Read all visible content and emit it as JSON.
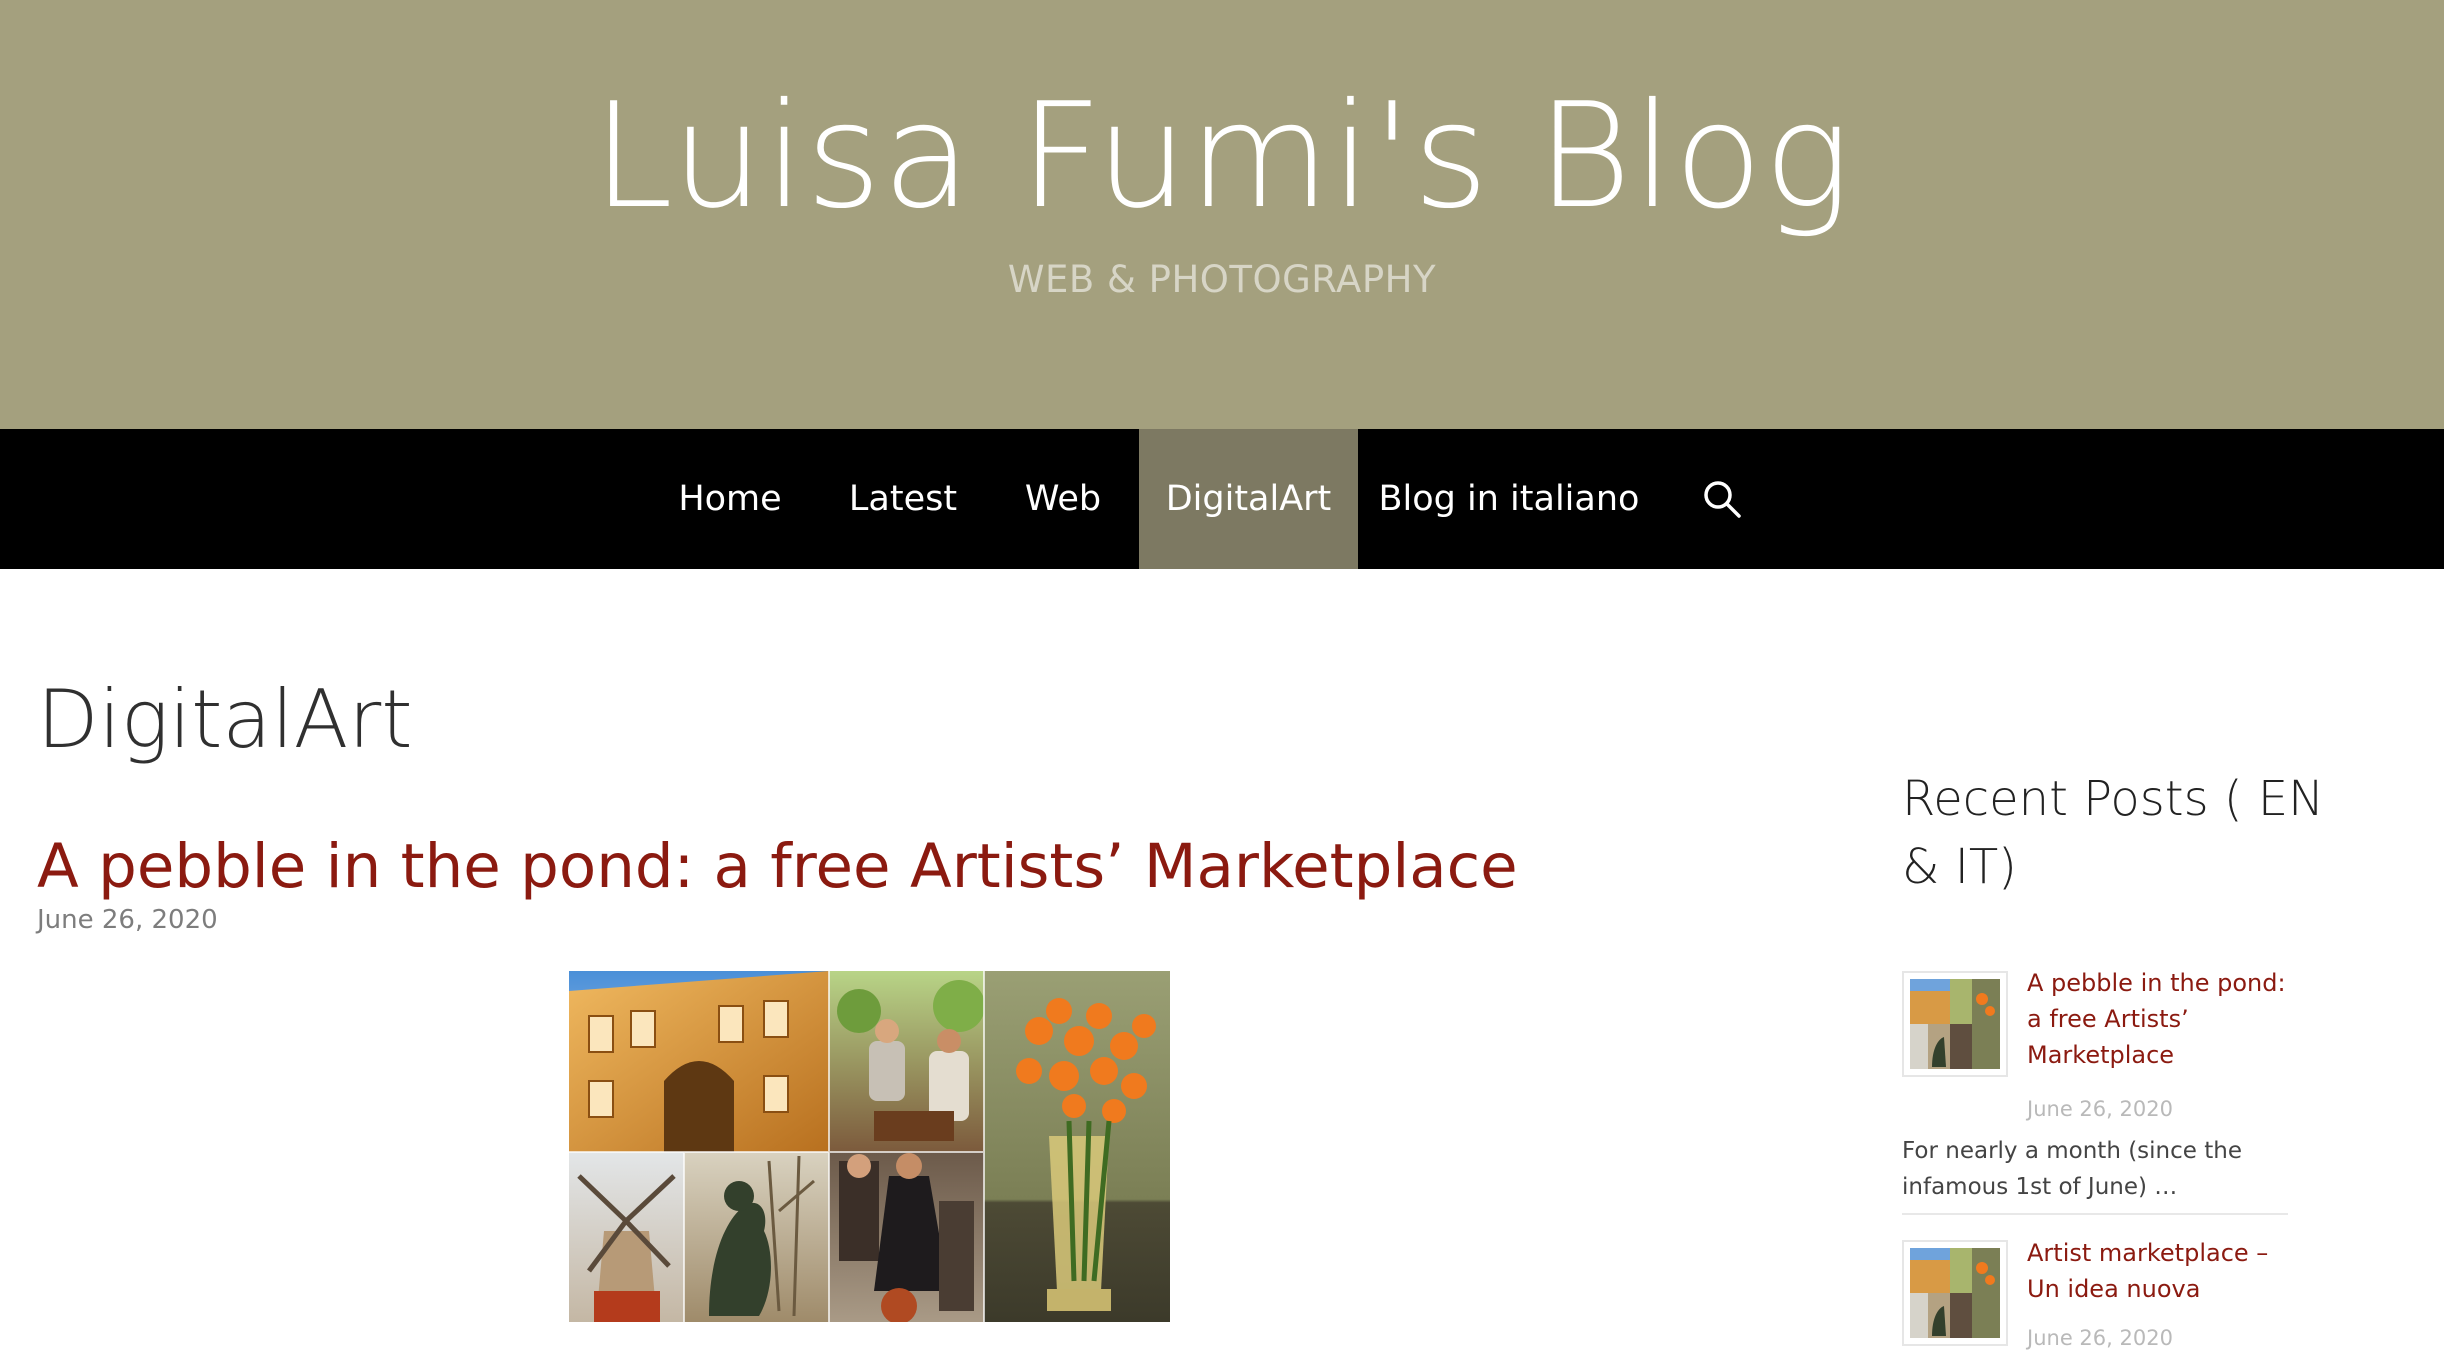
{
  "header": {
    "title": "Luisa Fumi's Blog",
    "tagline": "WEB & PHOTOGRAPHY",
    "background_color": "#a4a07e"
  },
  "nav": {
    "items": [
      {
        "label": "Home"
      },
      {
        "label": "Latest"
      },
      {
        "label": "Web"
      },
      {
        "label": "DigitalArt",
        "active": true
      },
      {
        "label": "Blog in italiano"
      }
    ],
    "search_icon": "search-icon",
    "active_color": "#7d7962"
  },
  "archive": {
    "title": "DigitalArt"
  },
  "post": {
    "title": "A pebble in the pond: a free Artists’ Marketplace",
    "date": "June 26, 2020",
    "title_color": "#8b1a10"
  },
  "sidebar": {
    "widget_title": "Recent Posts ( EN & IT)",
    "recent_posts": [
      {
        "title": "A pebble in the pond: a free Artists’ Marketplace",
        "date": "June 26, 2020",
        "excerpt": "For nearly a month (since the infamous 1st of June) …"
      },
      {
        "title": "Artist marketplace – Un idea nuova",
        "date": "June 26, 2020"
      }
    ]
  }
}
